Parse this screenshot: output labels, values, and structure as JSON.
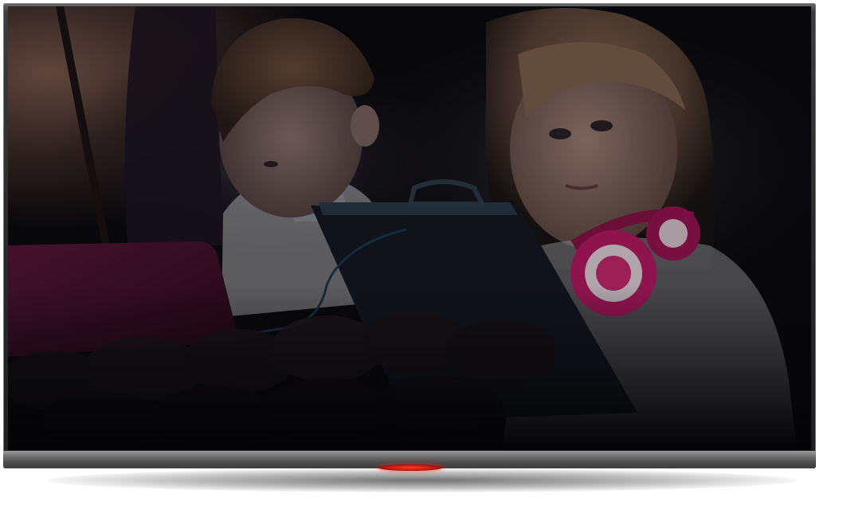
{
  "scene": {
    "subject": "photo",
    "colors": {
      "bezel": "#2a2a2a",
      "frame_silver": "#8a8a8a",
      "power_led": "#e0281a",
      "headphones": "#c21a6a",
      "laptop": "#4a0f2a",
      "screen_glow": "#1e2a3a",
      "background": "#07070b"
    }
  },
  "icons": {
    "power_indicator": "power-led-icon"
  }
}
